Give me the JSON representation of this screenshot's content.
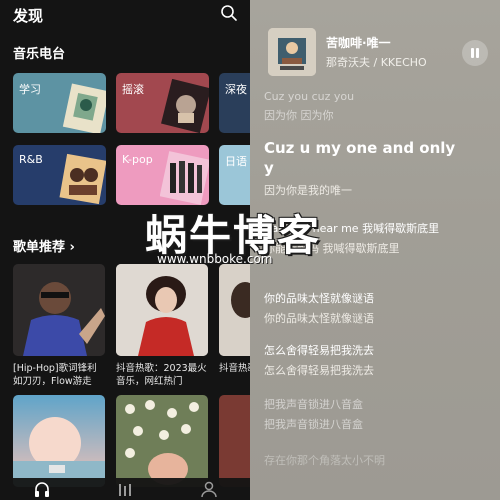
{
  "discover": {
    "title": "发现",
    "radio_section_title": "音乐电台",
    "radio_cards": [
      {
        "label": "学习",
        "color": "#5d93a3"
      },
      {
        "label": "摇滚",
        "color": "#a2484f"
      },
      {
        "label": "深夜",
        "color": "#2a3e5a"
      },
      {
        "label": "R&B",
        "color": "#263d6b"
      },
      {
        "label": "K-pop",
        "color": "#ee9bbf"
      },
      {
        "label": "日语",
        "color": "#9bc6d8"
      }
    ],
    "playlist_section_title": "歌单推荐 ›",
    "playlists": [
      {
        "title": "[Hip-Hop]歌词锋利如刀刃，Flow游走于..."
      },
      {
        "title": "抖音热歌：2023最火音乐，网红热门"
      },
      {
        "title": "抖音热歌全网超"
      }
    ]
  },
  "now_playing": {
    "title": "苦咖啡·唯一",
    "artist": "那奇沃夫 / KKECHO"
  },
  "lyrics": [
    {
      "main": "Cuz you cuz you",
      "sub": "因为你 因为你"
    },
    {
      "main": "Cuz u my one and only y",
      "sub": "因为你是我的唯一"
    },
    {
      "main": "Can you hear me 我喊得歇斯底里",
      "sub": "你能听到吗 我喊得歇斯底里"
    },
    {
      "main": "你的品味太怪就像谜语",
      "sub": "你的品味太怪就像谜语"
    },
    {
      "main": "怎么舍得轻易把我洗去",
      "sub": "怎么舍得轻易把我洗去"
    },
    {
      "main": "把我声音锁进八音盒",
      "sub": "把我声音锁进八音盒"
    },
    {
      "main": "存在你那个角落太小不明",
      "sub": ""
    }
  ],
  "watermark": {
    "text": "蜗牛博客",
    "url": "www.wnbboke.com"
  }
}
